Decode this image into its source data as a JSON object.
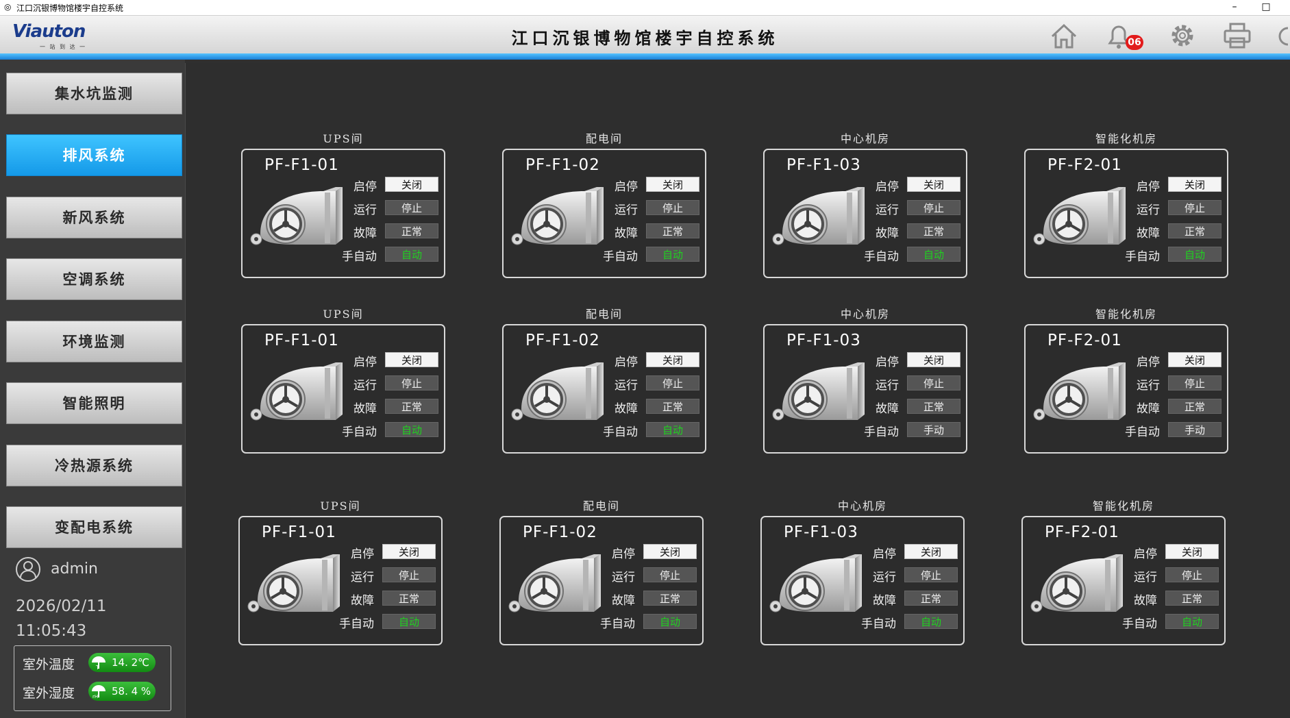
{
  "window": {
    "title": "江口沉银博物馆楼宇自控系统",
    "minimize": "–",
    "maximize": "□"
  },
  "header": {
    "logo_text": "Viauton",
    "logo_sub": "一 站 到 达 一",
    "system_title": "江口沉银博物馆楼宇自控系统",
    "alarm_count": "06"
  },
  "sidebar": {
    "items": [
      {
        "label": "集水坑监测",
        "active": false
      },
      {
        "label": "排风系统",
        "active": true
      },
      {
        "label": "新风系统",
        "active": false
      },
      {
        "label": "空调系统",
        "active": false
      },
      {
        "label": "环境监测",
        "active": false
      },
      {
        "label": "智能照明",
        "active": false
      },
      {
        "label": "冷热源系统",
        "active": false
      },
      {
        "label": "变配电系统",
        "active": false
      }
    ],
    "user": "admin",
    "date": "2026/02/11",
    "time": "11:05:43",
    "weather": {
      "temp_label": "室外温度",
      "temp_value": "14. 2℃",
      "humidity_label": "室外湿度",
      "humidity_value": "58. 4 %"
    }
  },
  "field_labels": {
    "start_stop": "启停",
    "run": "运行",
    "fault": "故障",
    "auto_manual": "手自动"
  },
  "rows": [
    [
      {
        "room": "UPS间",
        "code": "PF-F1-01",
        "start_stop": "关闭",
        "run": "停止",
        "fault": "正常",
        "mode": "自动"
      },
      {
        "room": "配电间",
        "code": "PF-F1-02",
        "start_stop": "关闭",
        "run": "停止",
        "fault": "正常",
        "mode": "自动"
      },
      {
        "room": "中心机房",
        "code": "PF-F1-03",
        "start_stop": "关闭",
        "run": "停止",
        "fault": "正常",
        "mode": "自动"
      },
      {
        "room": "智能化机房",
        "code": "PF-F2-01",
        "start_stop": "关闭",
        "run": "停止",
        "fault": "正常",
        "mode": "自动"
      }
    ],
    [
      {
        "room": "UPS间",
        "code": "PF-F1-01",
        "start_stop": "关闭",
        "run": "停止",
        "fault": "正常",
        "mode": "自动"
      },
      {
        "room": "配电间",
        "code": "PF-F1-02",
        "start_stop": "关闭",
        "run": "停止",
        "fault": "正常",
        "mode": "自动"
      },
      {
        "room": "中心机房",
        "code": "PF-F1-03",
        "start_stop": "关闭",
        "run": "停止",
        "fault": "正常",
        "mode": "手动"
      },
      {
        "room": "智能化机房",
        "code": "PF-F2-01",
        "start_stop": "关闭",
        "run": "停止",
        "fault": "正常",
        "mode": "手动"
      }
    ],
    [
      {
        "room": "UPS间",
        "code": "PF-F1-01",
        "start_stop": "关闭",
        "run": "停止",
        "fault": "正常",
        "mode": "自动"
      },
      {
        "room": "配电间",
        "code": "PF-F1-02",
        "start_stop": "关闭",
        "run": "停止",
        "fault": "正常",
        "mode": "自动"
      },
      {
        "room": "中心机房",
        "code": "PF-F1-03",
        "start_stop": "关闭",
        "run": "停止",
        "fault": "正常",
        "mode": "自动"
      },
      {
        "room": "智能化机房",
        "code": "PF-F2-01",
        "start_stop": "关闭",
        "run": "停止",
        "fault": "正常",
        "mode": "自动"
      }
    ]
  ],
  "colors": {
    "accent": "#1499e8",
    "auto_text": "#1fd21f",
    "alarm_badge": "#e21b1b",
    "weather_pill": "#138a13"
  },
  "icons": [
    "home-icon",
    "bell-icon",
    "gear-icon",
    "printer-icon",
    "user-icon",
    "fan-icon",
    "thermometer-icon",
    "humidity-icon"
  ]
}
